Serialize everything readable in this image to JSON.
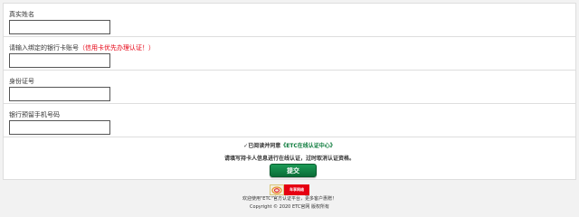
{
  "form": {
    "name_label": "真实姓名",
    "card_label": "请输入绑定的银行卡账号",
    "card_warning": "（信用卡优先办理认证！）",
    "id_label": "身份证号",
    "phone_label": "银行预留手机号码",
    "name_value": "",
    "card_value": "",
    "id_value": "",
    "phone_value": ""
  },
  "agree": {
    "prefix": "✓已阅读并同意",
    "link_text": "《ETC在线认证中心》"
  },
  "notice": "请填写持卡人信息进行在线认证，过时取消认证资格。",
  "submit_label": "提交",
  "logo": {
    "text": "车享网络"
  },
  "footer": {
    "line1": "欢迎使用\"ETC\"官方认证平台，更多客户惠赠！",
    "line2": "Copyright © 2020 ETC官网 版权所有"
  },
  "colors": {
    "accent_green": "#0b6d37",
    "warning_red": "#e60012"
  }
}
